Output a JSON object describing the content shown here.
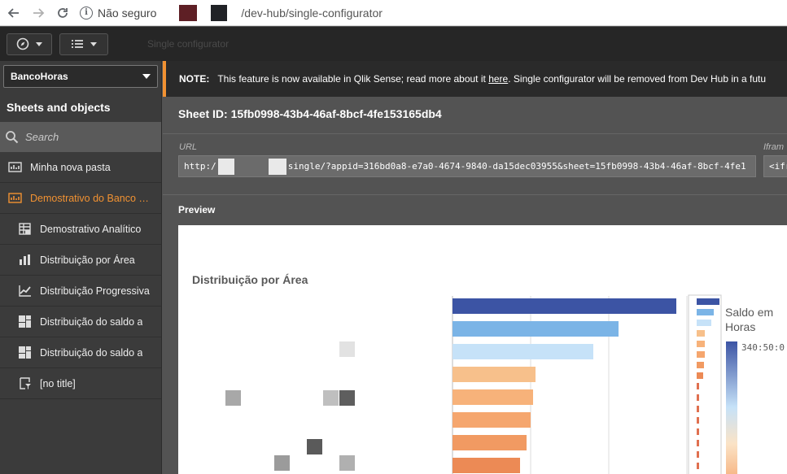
{
  "browser": {
    "security_label": "Não seguro",
    "path": "/dev-hub/single-configurator"
  },
  "toolbar": {
    "app_title": "Single configurator"
  },
  "sidebar": {
    "app_name": "BancoHoras",
    "heading": "Sheets and objects",
    "search_placeholder": "Search",
    "items": [
      {
        "label": "Minha nova pasta",
        "icon": "sheet-icon",
        "level": 0
      },
      {
        "label": "Demostrativo do Banco de Horas",
        "icon": "sheet-icon",
        "level": 0,
        "active": true
      },
      {
        "label": "Demostrativo Analítico",
        "icon": "table-icon",
        "level": 1
      },
      {
        "label": "Distribuição por Área",
        "icon": "bar-chart-icon",
        "level": 1
      },
      {
        "label": "Distribuição Progressiva",
        "icon": "line-chart-icon",
        "level": 1
      },
      {
        "label": "Distribuição do saldo a",
        "icon": "treemap-icon",
        "level": 1
      },
      {
        "label": "Distribuição do saldo a",
        "icon": "treemap-icon",
        "level": 1
      },
      {
        "label": "[no title]",
        "icon": "filter-icon",
        "level": 1
      }
    ]
  },
  "notice": {
    "prefix": "NOTE:",
    "text_before_link": "This feature is now available in Qlik Sense; read more about it",
    "link": "here",
    "text_after_link": ". Single configurator will be removed from Dev Hub in a futu"
  },
  "sheet": {
    "id_label": "Sheet ID: 15fb0998-43b4-46af-8bcf-4fe153165db4",
    "url_label": "URL",
    "url_prefix": "http:/",
    "url_value": "single/?appid=316bd0a8-e7a0-4674-9840-da15dec03955&sheet=15fb0998-43b4-46af-8bcf-4fe1",
    "iframe_label": "Ifram",
    "iframe_value": "<ifra",
    "preview_label": "Preview"
  },
  "chart_data": {
    "type": "bar",
    "orientation": "horizontal",
    "title": "Distribuição por Área",
    "legend_title": "Saldo em Horas",
    "legend_max": "340:50:0",
    "values": [
      100,
      74,
      63,
      37,
      36,
      35,
      33,
      30
    ],
    "colors": [
      "#3c54a4",
      "#7bb4e6",
      "#c6e2f8",
      "#f7c08b",
      "#f7b27a",
      "#f5a66e",
      "#f19a62",
      "#ec8a55"
    ],
    "xlim": [
      0,
      120
    ],
    "grid": true
  }
}
